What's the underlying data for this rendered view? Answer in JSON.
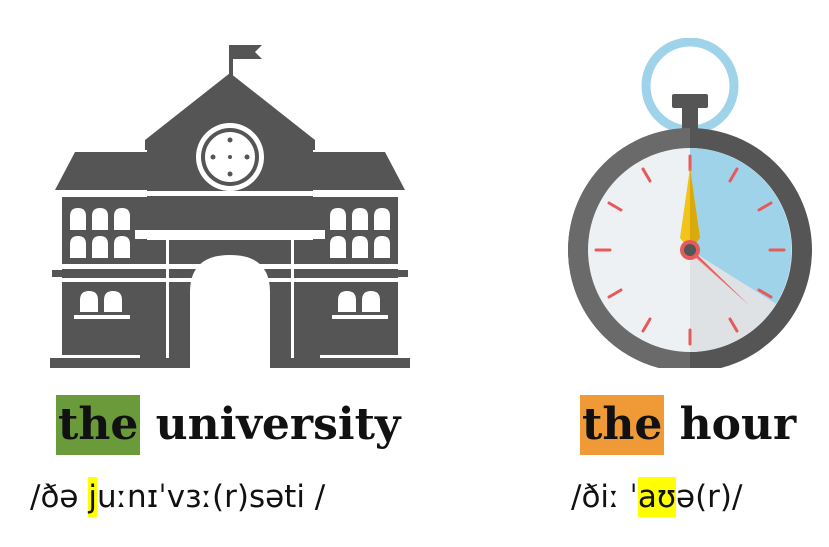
{
  "colors": {
    "left_article_highlight": "#6a9a3a",
    "right_article_highlight": "#ef9a36",
    "sound_highlight": "#ffff00",
    "icon_dark": "#555556",
    "stopwatch_blue": "#9fd3ea",
    "stopwatch_red": "#e65a5a",
    "stopwatch_yellow": "#f2c318"
  },
  "left": {
    "illustration": "university-building-icon",
    "article": "the",
    "noun": "university",
    "ipa_before": "/ðə ",
    "ipa_highlight": "j",
    "ipa_after": "uːnɪˈvɜː(r)səti /"
  },
  "right": {
    "illustration": "stopwatch-icon",
    "article": "the",
    "noun": "hour",
    "ipa_before": "/ðiː ˈ",
    "ipa_highlight": "aʊ",
    "ipa_after": "ə(r)/"
  }
}
